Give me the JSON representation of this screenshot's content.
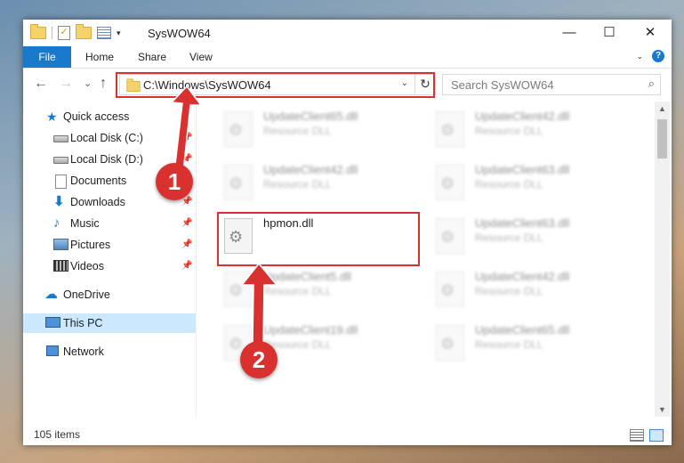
{
  "window": {
    "title": "SysWOW64",
    "minimize": "—",
    "maximize": "☐",
    "close": "✕"
  },
  "ribbon": {
    "tabs": [
      {
        "label": "File"
      },
      {
        "label": "Home"
      },
      {
        "label": "Share"
      },
      {
        "label": "View"
      }
    ],
    "help": "?"
  },
  "nav": {
    "back": "←",
    "forward": "→",
    "recent": "⌄",
    "up": "↑",
    "address": "C:\\Windows\\SysWOW64",
    "refresh": "↻",
    "search_placeholder": "Search SysWOW64",
    "search_icon": "⌕"
  },
  "sidebar": {
    "items": [
      {
        "label": "Quick access",
        "icon": "star-icon",
        "pinned": false
      },
      {
        "label": "Local Disk (C:)",
        "icon": "drive-icon",
        "pinned": true
      },
      {
        "label": "Local Disk (D:)",
        "icon": "drive-icon",
        "pinned": true
      },
      {
        "label": "Documents",
        "icon": "documents-icon",
        "pinned": true
      },
      {
        "label": "Downloads",
        "icon": "download-icon",
        "pinned": true
      },
      {
        "label": "Music",
        "icon": "music-icon",
        "pinned": true
      },
      {
        "label": "Pictures",
        "icon": "pictures-icon",
        "pinned": true
      },
      {
        "label": "Videos",
        "icon": "videos-icon",
        "pinned": true
      },
      {
        "label": "OneDrive",
        "icon": "cloud-icon",
        "pinned": false
      },
      {
        "label": "This PC",
        "icon": "computer-icon",
        "pinned": false,
        "selected": true
      },
      {
        "label": "Network",
        "icon": "network-icon",
        "pinned": false
      }
    ],
    "pin_glyph": "📌"
  },
  "files": [
    {
      "name": "UpdateClient65.dll",
      "type": "Resource DLL",
      "blurred": true
    },
    {
      "name": "UpdateClient42.dll",
      "type": "Resource DLL",
      "blurred": true
    },
    {
      "name": "UpdateClient42.dll",
      "type": "Resource DLL",
      "blurred": true
    },
    {
      "name": "UpdateClient63.dll",
      "type": "Resource DLL",
      "blurred": true
    },
    {
      "name": "hpmon.dll",
      "type": "",
      "blurred": false
    },
    {
      "name": "UpdateClient63.dll",
      "type": "Resource DLL",
      "blurred": true
    },
    {
      "name": "UpdateClient5.dll",
      "type": "Resource DLL",
      "blurred": true
    },
    {
      "name": "UpdateClient42.dll",
      "type": "Resource DLL",
      "blurred": true
    },
    {
      "name": "UpdateClient19.dll",
      "type": "Resource DLL",
      "blurred": true
    },
    {
      "name": "UpdateClient65.dll",
      "type": "Resource DLL",
      "blurred": true
    }
  ],
  "status": {
    "item_count": "105 items"
  },
  "annotations": {
    "step1": "1",
    "step2": "2",
    "color": "#d9312f"
  }
}
